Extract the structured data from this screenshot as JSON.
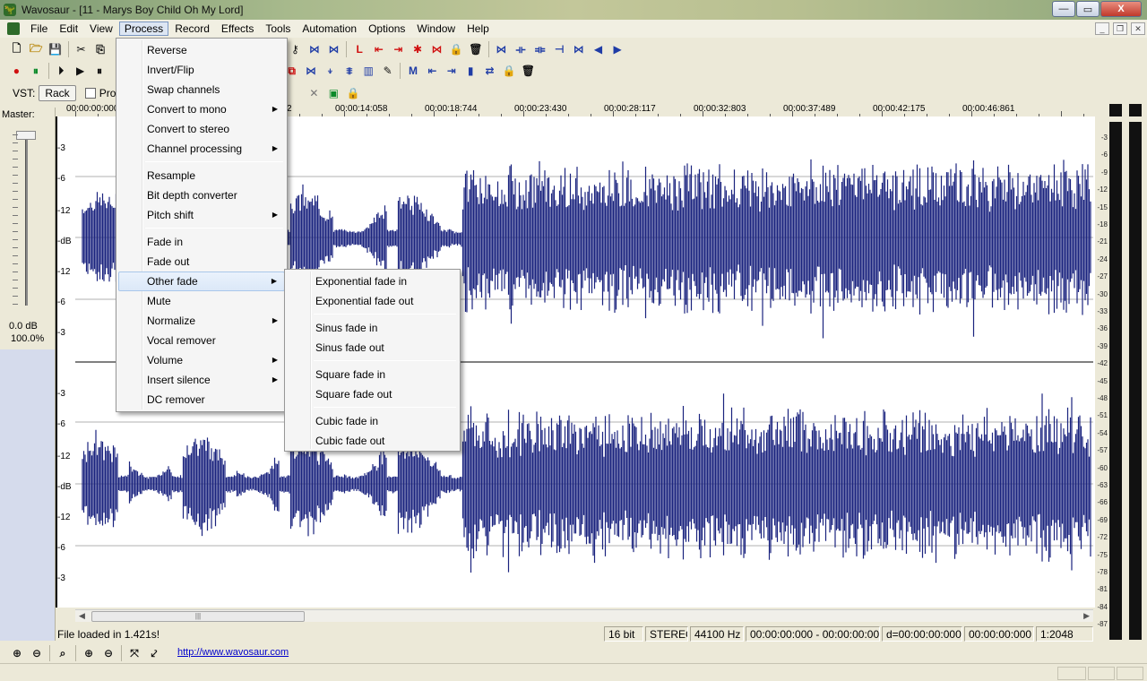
{
  "window": {
    "title": "Wavosaur - [11 - Marys Boy Child  Oh My Lord]",
    "app_icon": "dinosaur-icon",
    "minimize_label": "—",
    "maximize_label": "▭",
    "close_label": "X"
  },
  "menubar": {
    "items": [
      "File",
      "Edit",
      "View",
      "Process",
      "Record",
      "Effects",
      "Tools",
      "Automation",
      "Options",
      "Window",
      "Help"
    ],
    "active": "Process"
  },
  "vst": {
    "label": "VST:",
    "rack_label": "Rack",
    "checkbox_label": "Pro"
  },
  "master": {
    "label": "Master:",
    "db_value": "0.0 dB",
    "percent": "100.0%",
    "level_fraction": 0.0
  },
  "ruler": {
    "labels": [
      "00:00:00:000",
      "2",
      "00:00:14:058",
      "00:00:18:744",
      "00:00:23:430",
      "00:00:28:117",
      "00:00:32:803",
      "00:00:37:489",
      "00:00:42:175",
      "00:00:46:861"
    ]
  },
  "channels": {
    "db_labels_top": [
      "-3",
      "-6",
      "-12",
      "-dB",
      "-12",
      "-6",
      "-3"
    ],
    "db_labels_bottom": [
      "-3",
      "-6",
      "-12",
      "-dB",
      "-12",
      "-6",
      "-3"
    ],
    "waveform_color": "#1a237e"
  },
  "vu_meter": {
    "labels": [
      "-3",
      "-6",
      "-9",
      "-12",
      "-15",
      "-18",
      "-21",
      "-24",
      "-27",
      "-30",
      "-33",
      "-36",
      "-39",
      "-42",
      "-45",
      "-48",
      "-51",
      "-54",
      "-57",
      "-60",
      "-63",
      "-66",
      "-69",
      "-72",
      "-75",
      "-78",
      "-81",
      "-84",
      "-87"
    ]
  },
  "status": {
    "message": "File loaded in 1.421s!",
    "bit_depth": "16 bit",
    "channels": "STEREO",
    "sample_rate": "44100 Hz",
    "selection": "00:00:00:000 - 00:00:00:000",
    "duration": "d=00:00:00:000",
    "position": "00:00:00:000",
    "zoom": "1:2048"
  },
  "website": "http://www.wavosaur.com",
  "process_menu": {
    "items": [
      {
        "label": "Reverse",
        "submenu": false
      },
      {
        "label": "Invert/Flip",
        "submenu": false
      },
      {
        "label": "Swap channels",
        "submenu": false
      },
      {
        "label": "Convert to mono",
        "submenu": true
      },
      {
        "label": "Convert to stereo",
        "submenu": false
      },
      {
        "label": "Channel processing",
        "submenu": true
      },
      {
        "label": "Resample",
        "submenu": false
      },
      {
        "label": "Bit depth converter",
        "submenu": false
      },
      {
        "label": "Pitch shift",
        "submenu": true
      },
      {
        "label": "Fade in",
        "submenu": false
      },
      {
        "label": "Fade out",
        "submenu": false
      },
      {
        "label": "Other fade",
        "submenu": true
      },
      {
        "label": "Mute",
        "submenu": false
      },
      {
        "label": "Normalize",
        "submenu": true
      },
      {
        "label": "Vocal remover",
        "submenu": false
      },
      {
        "label": "Volume",
        "submenu": true
      },
      {
        "label": "Insert silence",
        "submenu": true
      },
      {
        "label": "DC remover",
        "submenu": false
      }
    ],
    "highlighted": "Other fade"
  },
  "other_fade_menu": {
    "items": [
      "Exponential fade in",
      "Exponential fade out",
      "Sinus fade in",
      "Sinus fade out",
      "Square fade in",
      "Square fade out",
      "Cubic fade in",
      "Cubic fade out"
    ]
  }
}
